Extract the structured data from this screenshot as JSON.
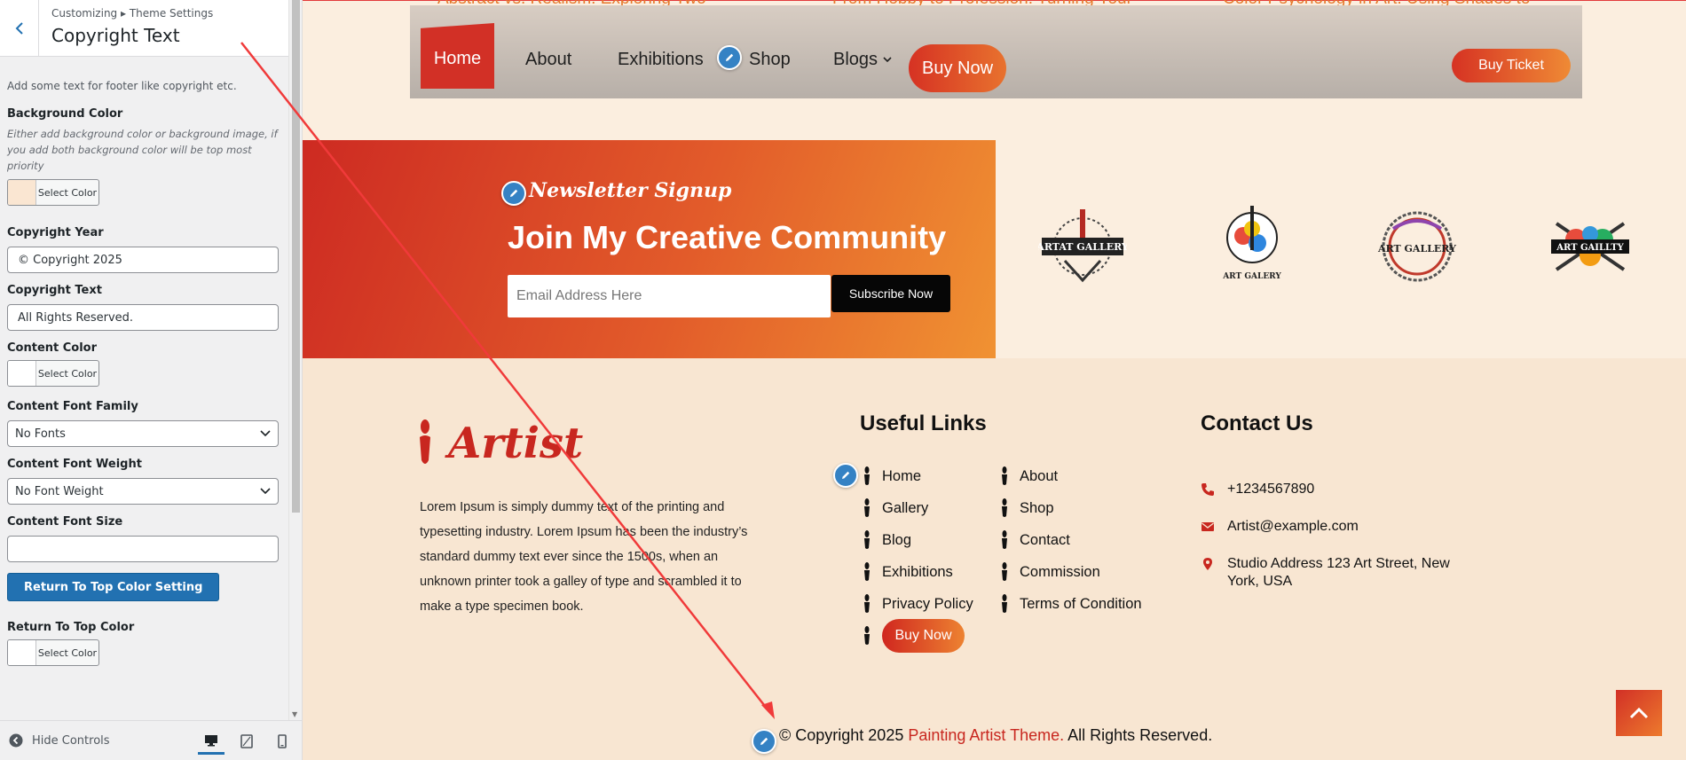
{
  "sidebar": {
    "breadcrumb": "Customizing ▸ Theme Settings",
    "title": "Copyright Text",
    "description": "Add some text for footer like copyright etc.",
    "background_color": {
      "label": "Background Color",
      "help": "Either add background color or background image, if you add both background color will be top most priority",
      "button": "Select Color",
      "swatch": "#fae6d2"
    },
    "copyright_year": {
      "label": "Copyright Year",
      "value": "© Copyright 2025"
    },
    "copyright_text": {
      "label": "Copyright Text",
      "value": "All Rights Reserved."
    },
    "content_color": {
      "label": "Content Color",
      "button": "Select Color",
      "swatch": "#ffffff"
    },
    "font_family": {
      "label": "Content Font Family",
      "value": "No Fonts"
    },
    "font_weight": {
      "label": "Content Font Weight",
      "value": "No Font Weight"
    },
    "font_size": {
      "label": "Content Font Size",
      "value": ""
    },
    "return_button": "Return To Top Color Setting",
    "return_color": {
      "label": "Return To Top Color",
      "button": "Select Color",
      "swatch": "#ffffff"
    },
    "footer": {
      "hide_controls": "Hide Controls"
    }
  },
  "preview": {
    "post_peeks": [
      "Abstract vs. Realism: Exploring Two",
      "From Hobby to Profession: Turning Your",
      "Color Psychology in Art: Using Shades to"
    ],
    "nav": {
      "home": "Home",
      "about": "About",
      "exhibitions": "Exhibitions",
      "shop": "Shop",
      "blogs": "Blogs",
      "buy_now": "Buy Now",
      "buy_ticket": "Buy Ticket"
    },
    "newsletter": {
      "kicker": "Newsletter Signup",
      "title": "Join My Creative Community",
      "email_placeholder": "Email Address Here",
      "subscribe": "Subscribe Now"
    },
    "logos": [
      "ARTAT GALLERY",
      "ART GALERY",
      "ART GALLERY",
      "ART GAILLTY"
    ],
    "footer": {
      "brand": "Artist",
      "about": "Lorem Ipsum is simply dummy text of the printing and typesetting industry. Lorem Ipsum has been the industry’s standard dummy text ever since the 1500s, when an unknown printer took a galley of type and scrambled it to make a type specimen book.",
      "links_title": "Useful Links",
      "links": [
        "Home",
        "About",
        "Gallery",
        "Shop",
        "Blog",
        "Contact",
        "Exhibitions",
        "Commission",
        "Privacy Policy",
        "Terms of Condition"
      ],
      "buy_now": "Buy Now",
      "contact_title": "Contact Us",
      "phone": "+1234567890",
      "email": "Artist@example.com",
      "address": "Studio Address 123 Art Street, New York, USA",
      "copyright_prefix": "© Copyright 2025",
      "copyright_brand": "Painting Artist Theme.",
      "copyright_suffix": "All Rights Reserved."
    }
  },
  "colors": {
    "accent": "#c8271f",
    "wp_blue": "#2271b1",
    "annotation_arrow": "#f03a3a"
  }
}
